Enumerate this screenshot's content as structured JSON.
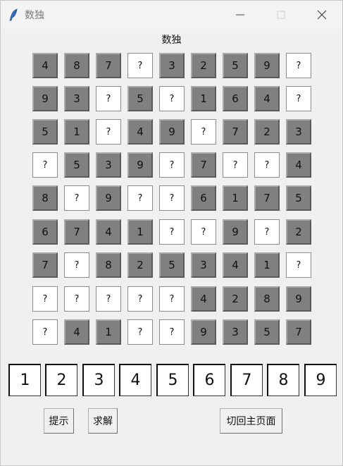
{
  "window": {
    "title": "数独",
    "icon": "feather-icon"
  },
  "heading": "数独",
  "board": [
    [
      "4",
      "8",
      "7",
      "?",
      "3",
      "2",
      "5",
      "9",
      "?"
    ],
    [
      "9",
      "3",
      "?",
      "5",
      "?",
      "1",
      "6",
      "4",
      "?"
    ],
    [
      "5",
      "1",
      "?",
      "4",
      "9",
      "?",
      "7",
      "2",
      "3"
    ],
    [
      "?",
      "5",
      "3",
      "9",
      "?",
      "7",
      "?",
      "?",
      "4"
    ],
    [
      "8",
      "?",
      "9",
      "?",
      "?",
      "6",
      "1",
      "7",
      "5"
    ],
    [
      "6",
      "7",
      "4",
      "1",
      "?",
      "?",
      "9",
      "?",
      "2"
    ],
    [
      "7",
      "?",
      "8",
      "2",
      "5",
      "3",
      "4",
      "1",
      "?"
    ],
    [
      "?",
      "?",
      "?",
      "?",
      "?",
      "4",
      "2",
      "8",
      "9"
    ],
    [
      "?",
      "4",
      "1",
      "?",
      "?",
      "9",
      "3",
      "5",
      "7"
    ]
  ],
  "number_pad": [
    "1",
    "2",
    "3",
    "4",
    "5",
    "6",
    "7",
    "8",
    "9"
  ],
  "buttons": {
    "hint": "提示",
    "solve": "求解",
    "back_home": "切回主页面"
  },
  "colors": {
    "given_cell": "#808080",
    "blank_cell": "#ffffff",
    "background": "#f0f0f0"
  }
}
